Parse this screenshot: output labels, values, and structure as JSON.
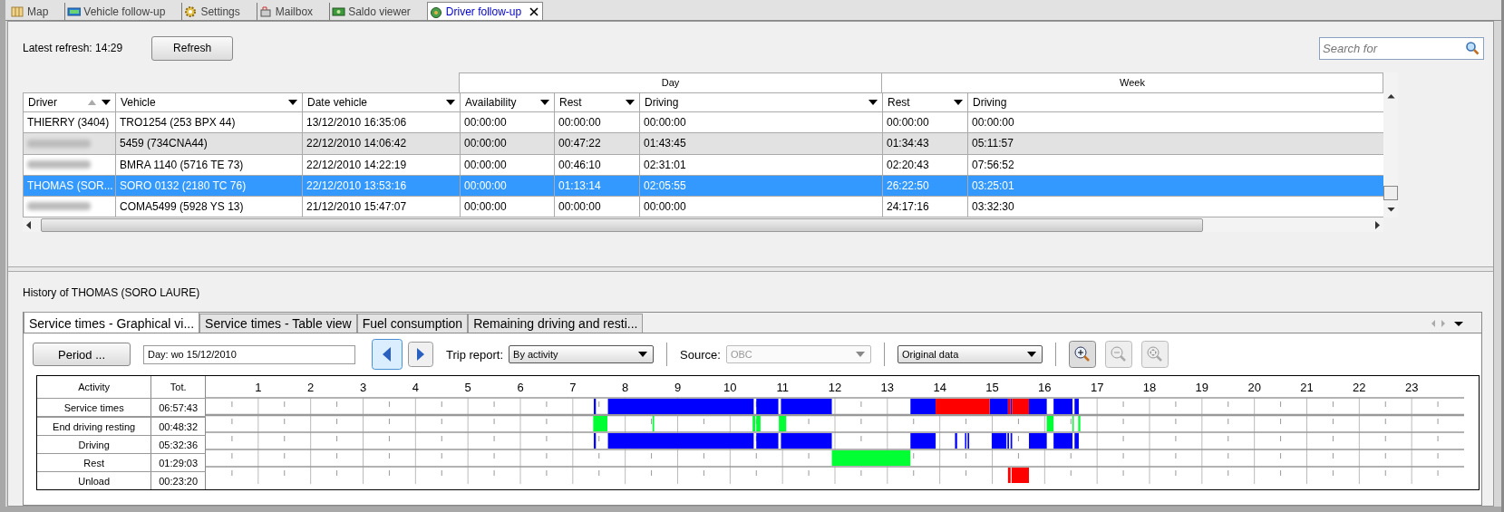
{
  "app_tabs": [
    {
      "label": "Map",
      "selected": false,
      "closable": false
    },
    {
      "label": "Vehicle follow-up",
      "selected": false,
      "closable": false
    },
    {
      "label": "Settings",
      "selected": false,
      "closable": false
    },
    {
      "label": "Mailbox",
      "selected": false,
      "closable": false
    },
    {
      "label": "Saldo viewer",
      "selected": false,
      "closable": false
    },
    {
      "label": "Driver follow-up",
      "selected": true,
      "closable": true
    }
  ],
  "refresh": {
    "label": "Latest refresh: 14:29",
    "button": "Refresh"
  },
  "search": {
    "placeholder": "Search for"
  },
  "table": {
    "groups": [
      {
        "label": "Day"
      },
      {
        "label": "Week"
      }
    ],
    "columns": [
      {
        "label": "Driver",
        "sorted": true
      },
      {
        "label": "Vehicle",
        "sorted": false
      },
      {
        "label": "Date vehicle",
        "sorted": false
      },
      {
        "label": "Availability",
        "sorted": false
      },
      {
        "label": "Rest",
        "sorted": false
      },
      {
        "label": "Driving",
        "sorted": false
      },
      {
        "label": "Rest",
        "sorted": false
      },
      {
        "label": "Driving",
        "sorted": false
      }
    ],
    "rows": [
      {
        "selected": false,
        "highlighted": false,
        "redacted": false,
        "cells": [
          "THIERRY (3404)",
          "TRO1254 (253 BPX 44)",
          "13/12/2010 16:35:06",
          "00:00:00",
          "00:00:00",
          "00:00:00",
          "00:00:00",
          "00:00:00"
        ]
      },
      {
        "selected": false,
        "highlighted": true,
        "redacted": true,
        "cells": [
          "",
          "5459 (734CNA44)",
          "22/12/2010 14:06:42",
          "00:00:00",
          "00:47:22",
          "01:43:45",
          "01:34:43",
          "05:11:57"
        ]
      },
      {
        "selected": false,
        "highlighted": false,
        "redacted": true,
        "cells": [
          "",
          "BMRA 1140  (5716 TE 73)",
          "22/12/2010 14:22:19",
          "00:00:00",
          "00:46:10",
          "02:31:01",
          "02:20:43",
          "07:56:52"
        ]
      },
      {
        "selected": true,
        "highlighted": false,
        "redacted": false,
        "cells": [
          "THOMAS (SOR...",
          "SORO 0132 (2180 TC 76)",
          "22/12/2010 13:53:16",
          "00:00:00",
          "01:13:14",
          "02:05:55",
          "26:22:50",
          "03:25:01"
        ]
      },
      {
        "selected": false,
        "highlighted": false,
        "redacted": true,
        "cells": [
          "",
          "COMA5499 (5928 YS 13)",
          "21/12/2010 15:47:07",
          "00:00:00",
          "00:00:00",
          "00:00:00",
          "24:17:16",
          "03:32:30"
        ]
      }
    ]
  },
  "history": {
    "title": "History of THOMAS (SORO LAURE)",
    "tabs": [
      {
        "label": "Service times - Graphical vi...",
        "selected": true
      },
      {
        "label": "Service times - Table view",
        "selected": false
      },
      {
        "label": "Fuel consumption",
        "selected": false
      },
      {
        "label": "Remaining driving and resti...",
        "selected": false
      }
    ],
    "period_button": "Period ...",
    "day_field": "Day: wo 15/12/2010",
    "trip_report_label": "Trip report:",
    "trip_report": "By activity",
    "source_label": "Source:",
    "source": "OBC",
    "data_mode": "Original data",
    "activity_header": "Activity",
    "total_header": "Tot.",
    "hours": [
      "1",
      "2",
      "3",
      "4",
      "5",
      "6",
      "7",
      "8",
      "9",
      "10",
      "11",
      "12",
      "13",
      "14",
      "15",
      "16",
      "17",
      "18",
      "19",
      "20",
      "21",
      "22",
      "23"
    ],
    "activities": [
      {
        "label": "Service times",
        "total": "06:57:43"
      },
      {
        "label": "End driving resting",
        "total": "00:48:32"
      },
      {
        "label": "Driving",
        "total": "05:32:36"
      },
      {
        "label": "Rest",
        "total": "01:29:03"
      },
      {
        "label": "Unload",
        "total": "00:23:20"
      }
    ]
  }
}
